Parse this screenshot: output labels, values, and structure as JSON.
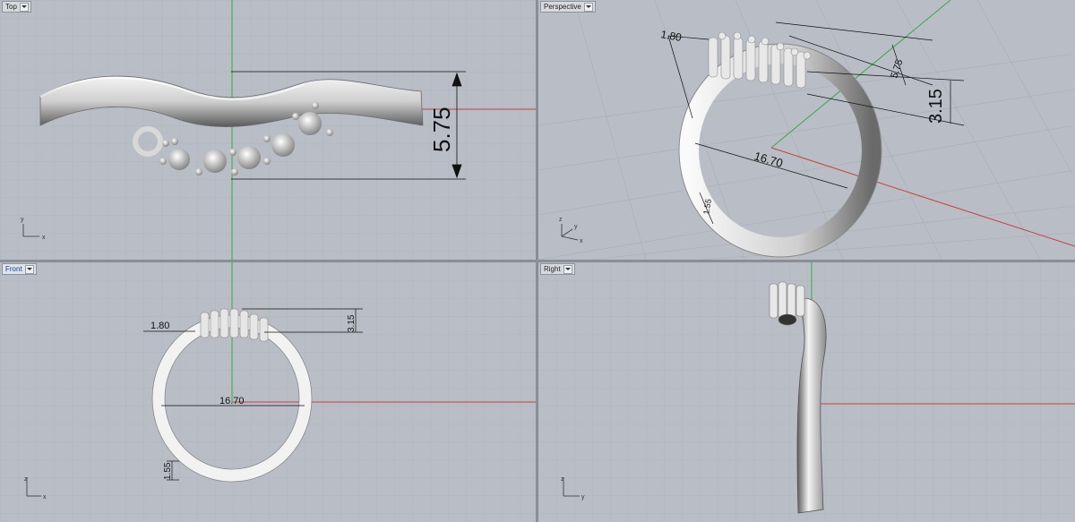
{
  "viewports": {
    "top": {
      "label": "Top",
      "active": false
    },
    "perspective": {
      "label": "Perspective",
      "active": false
    },
    "front": {
      "label": "Front",
      "active": true
    },
    "right": {
      "label": "Right",
      "active": false
    }
  },
  "dimensions": {
    "height_top": "5.75",
    "width_persp": "1.80",
    "height_persp_small": "5.75",
    "height_persp_large": "3.15",
    "diameter_persp": "16.70",
    "thickness_persp": "1.55",
    "width_front": "1.80",
    "height_front": "3.15",
    "diameter_front": "16.70",
    "thickness_front": "1.55"
  },
  "axes": {
    "x": "x",
    "y": "y",
    "z": "z"
  },
  "colors": {
    "viewport_bg": "#b9bec6",
    "grid_line": "#a9aeb6",
    "x_axis": "#c8413c",
    "y_axis": "#3aa84a"
  }
}
